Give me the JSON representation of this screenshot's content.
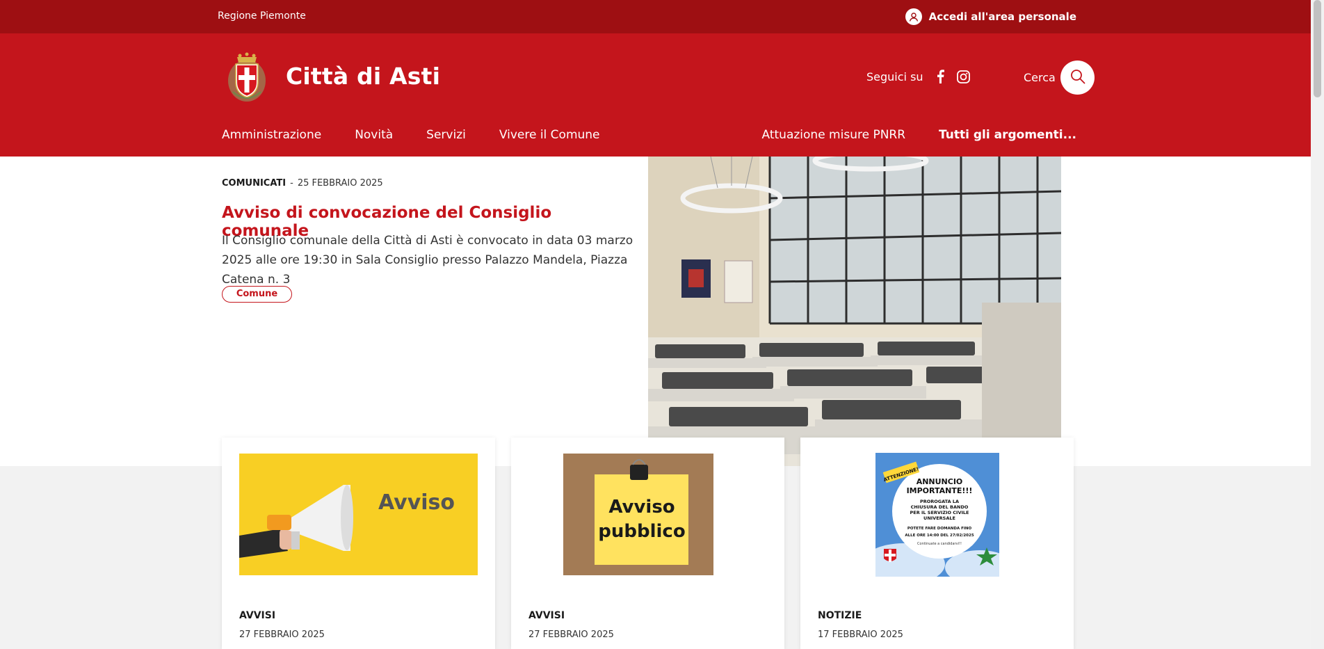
{
  "topbar": {
    "region": "Regione Piemonte",
    "login_label": "Accedi all'area personale"
  },
  "header": {
    "site_title": "Città di Asti",
    "social_label": "Seguici su",
    "search_label": "Cerca"
  },
  "nav": {
    "left": [
      "Amministrazione",
      "Novità",
      "Servizi",
      "Vivere il Comune"
    ],
    "right": [
      "Attuazione misure PNRR",
      "Tutti gli argomenti..."
    ]
  },
  "hero": {
    "category": "COMUNICATI",
    "separator": "-",
    "date": "25 FEBBRAIO 2025",
    "title": "Avviso di convocazione del Consiglio comunale",
    "description": "Il Consiglio comunale della Città di Asti è convocato in data 03 marzo 2025 alle ore 19:30 in Sala Consiglio presso Palazzo Mandela, Piazza Catena n. 3",
    "tag": "Comune"
  },
  "cards": [
    {
      "category": "AVVISI",
      "date": "27 FEBBRAIO 2025",
      "image_text": "Avviso"
    },
    {
      "category": "AVVISI",
      "date": "27 FEBBRAIO 2025",
      "image_text_1": "Avviso",
      "image_text_2": "pubblico"
    },
    {
      "category": "NOTIZIE",
      "date": "17 FEBBRAIO 2025",
      "image_badge": "ATTENZIONE!",
      "image_title_1": "ANNUNCIO",
      "image_title_2": "IMPORTANTE!!!",
      "image_line_1": "PROROGATA LA",
      "image_line_2": "CHIUSURA DEL BANDO",
      "image_line_3": "PER IL SERVIZIO CIVILE",
      "image_line_4": "UNIVERSALE",
      "image_line_5": "POTETE FARE DOMANDA FINO",
      "image_line_6": "ALLE ORE 14:00 DEL 27/02/2025",
      "image_line_7": "Continuate a candidarvi!!"
    }
  ],
  "colors": {
    "topbar": "#9e0f12",
    "header": "#c4151c",
    "accent": "#c4151c",
    "page_bg": "#f2f2f2"
  }
}
